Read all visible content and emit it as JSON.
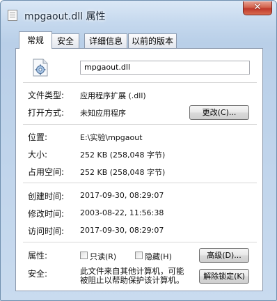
{
  "window": {
    "title": "mpgaout.dll 属性",
    "close_glyph": "✕"
  },
  "tabs": [
    "常规",
    "安全",
    "详细信息",
    "以前的版本"
  ],
  "general": {
    "file_name": "mpgaout.dll",
    "rows": {
      "type_label": "文件类型:",
      "type_value": "应用程序扩展 (.dll)",
      "open_label": "打开方式:",
      "open_value": "未知应用程序",
      "change_button": "更改(C)...",
      "location_label": "位置:",
      "location_value": "E:\\实验\\mpgaout",
      "size_label": "大小:",
      "size_value": "252 KB (258,048 字节)",
      "disk_label": "占用空间:",
      "disk_value": "252 KB (258,048 字节)",
      "created_label": "创建时间:",
      "created_value": "2017-09-30, 08:29:07",
      "modified_label": "修改时间:",
      "modified_value": "2003-08-22, 11:56:38",
      "accessed_label": "访问时间:",
      "accessed_value": "2017-09-30, 08:29:07",
      "attr_label": "属性:",
      "readonly": "只读(R)",
      "hidden": "隐藏(H)",
      "advanced_button": "高级(D)...",
      "security_label": "安全:",
      "security_text_1": "此文件来自其他计算机，可能",
      "security_text_2": "被阻止以帮助保护该计算机。",
      "unblock_button": "解除锁定(K)"
    }
  },
  "icons": {
    "title": "dll-file-icon",
    "file": "dll-gear-file-icon",
    "close": "close-icon"
  }
}
